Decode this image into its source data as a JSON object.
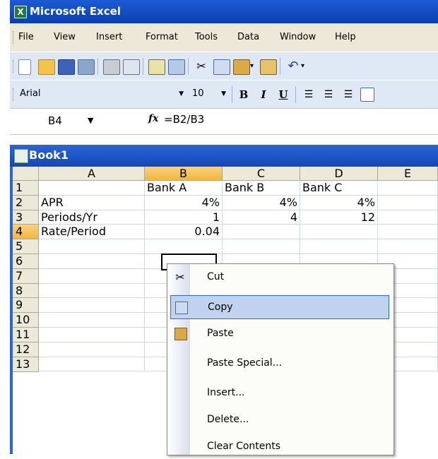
{
  "app": {
    "title": "Microsoft Excel"
  },
  "menubar": {
    "items": [
      "File",
      "View",
      "Insert",
      "Format",
      "Tools",
      "Data",
      "Window",
      "Help"
    ]
  },
  "toolbar": {
    "font_name": "Arial",
    "font_size": "10",
    "bold": "B",
    "italic": "I",
    "underline": "U"
  },
  "formula_bar": {
    "name_box": "B4",
    "fx": "fx",
    "formula": "=B2/B3"
  },
  "workbook": {
    "title": "Book1"
  },
  "grid": {
    "columns": [
      "A",
      "B",
      "C",
      "D",
      "E"
    ],
    "rows": [
      "1",
      "2",
      "3",
      "4",
      "5",
      "6",
      "7",
      "8",
      "9",
      "10",
      "11",
      "12",
      "13"
    ],
    "cells": {
      "B1": "Bank A",
      "C1": "Bank B",
      "D1": "Bank C",
      "A2": "APR",
      "B2": "4%",
      "C2": "4%",
      "D2": "4%",
      "A3": "Periods/Yr",
      "B3": "1",
      "C3": "4",
      "D3": "12",
      "A4": "Rate/Period",
      "B4": "0.04"
    },
    "selected_cell": "B4"
  },
  "context_menu": {
    "items": [
      "Cut",
      "Copy",
      "Paste",
      "Paste Special...",
      "Insert...",
      "Delete...",
      "Clear Contents"
    ],
    "highlighted": "Copy"
  },
  "colors": {
    "title_blue": "#0a3fb0",
    "selection_orange": "#f4b63f",
    "menu_highlight": "#c1d2ee"
  }
}
